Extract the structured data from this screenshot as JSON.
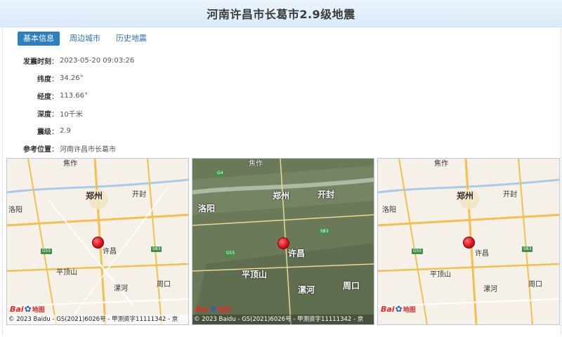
{
  "header": {
    "title": "河南许昌市长葛市2.9级地震"
  },
  "tabs": [
    {
      "label": "基本信息",
      "active": true
    },
    {
      "label": "周边城市",
      "active": false
    },
    {
      "label": "历史地震",
      "active": false
    }
  ],
  "info": [
    {
      "key": "发震时刻",
      "value": "2023-05-20 09:03:26"
    },
    {
      "key": "纬度",
      "value": "34.26°"
    },
    {
      "key": "经度",
      "value": "113.66°"
    },
    {
      "key": "深度",
      "value": "10千米"
    },
    {
      "key": "震级",
      "value": "2.9"
    },
    {
      "key": "参考位置",
      "value": "河南许昌市长葛市"
    }
  ],
  "maps": {
    "cities": {
      "zhengzhou": "郑州",
      "kaifeng": "开封",
      "luoyang": "洛阳",
      "xuchang": "许昌",
      "pingdingshan": "平顶山",
      "luohe": "漯河",
      "zhoukou": "周口",
      "jiaozuo": "焦作"
    },
    "copyright_full": "© 2023 Baidu - GS(2021)6026号 - 甲测资字11111342 - 京",
    "logo": {
      "bai": "Bai",
      "du": "地图"
    },
    "road_shields": [
      "G55",
      "S83",
      "G4",
      "S83",
      "G55"
    ],
    "colors": {
      "epicenter": "#d0101a",
      "road_major": "#f2c04d",
      "road_minor": "#ffffff",
      "river": "#a9cbe8"
    }
  }
}
